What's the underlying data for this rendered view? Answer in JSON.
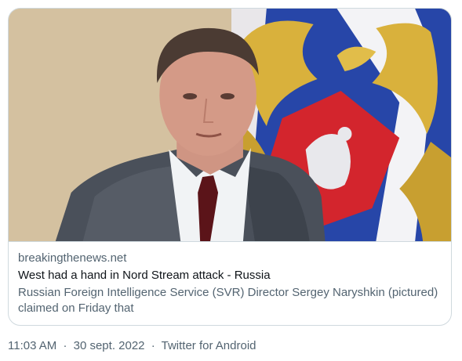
{
  "card": {
    "domain": "breakingthenews.net",
    "headline": "West had a hand in Nord Stream attack - Russia",
    "description": "Russian Foreign Intelligence Service (SVR) Director Sergey Naryshkin (pictured) claimed on Friday that"
  },
  "meta": {
    "time": "11:03 AM",
    "date": "30 sept. 2022",
    "separator": "·",
    "source": "Twitter for Android"
  },
  "colors": {
    "border": "#cfd9de",
    "secondary_text": "#536471",
    "primary_text": "#0f1419",
    "flag_blue": "#2746a8",
    "flag_gold": "#d9b13c",
    "emblem_red": "#d3252d"
  }
}
